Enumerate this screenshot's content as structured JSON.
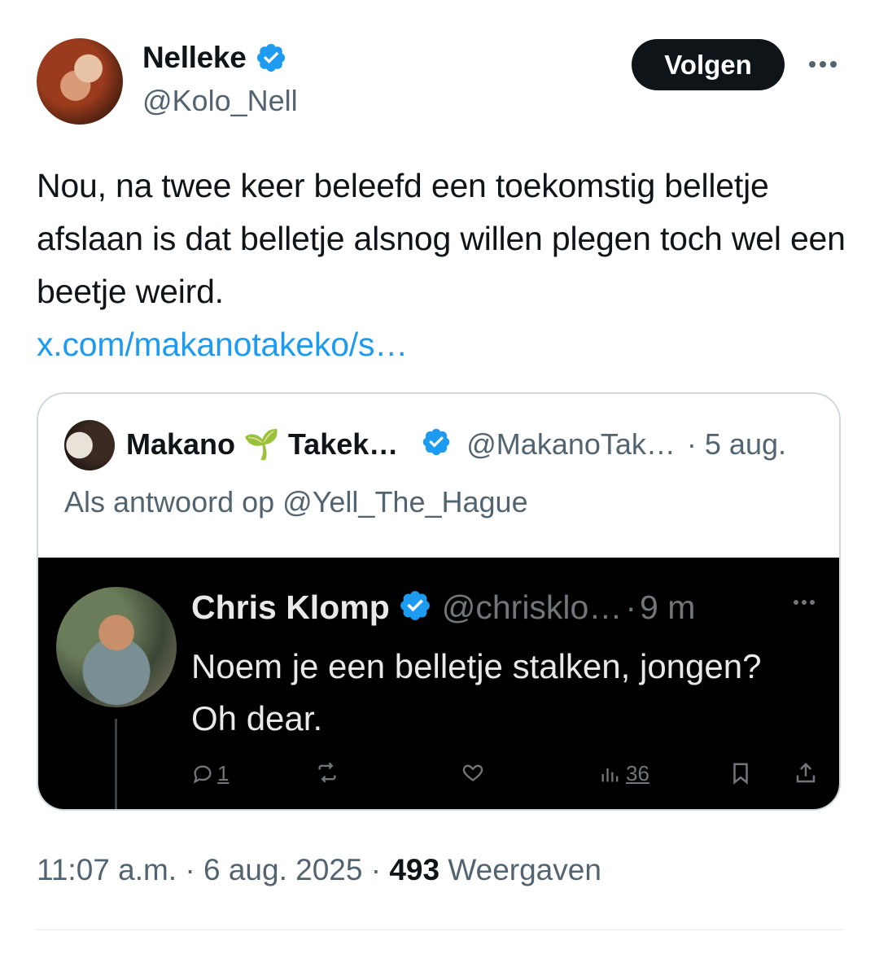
{
  "author": {
    "name": "Nelleke",
    "handle": "@Kolo_Nell",
    "follow_label": "Volgen"
  },
  "tweet": {
    "text": "Nou, na twee keer beleefd een toekomstig belletje afslaan is dat belletje alsnog willen plegen toch wel een beetje weird.",
    "link": "x.com/makanotakeko/s…"
  },
  "quote": {
    "name": "Makano 🌱 Takek…",
    "handle": "@MakanoTak…",
    "separator": "·",
    "date": "5 aug.",
    "reply_to": "Als antwoord op @Yell_The_Hague",
    "embedded": {
      "name": "Chris Klomp",
      "handle": "@chrisklo…",
      "separator": "·",
      "time": "9 m",
      "text": "Noem je een belletje stalken, jongen? Oh dear.",
      "reply_count": "1",
      "view_count": "36"
    }
  },
  "footer": {
    "time": "11:07 a.m.",
    "dot1": "·",
    "date": "6 aug. 2025",
    "dot2": "·",
    "views": "493",
    "views_label": "Weergaven"
  },
  "colors": {
    "accent": "#1d9bf0",
    "text": "#0f1419",
    "muted": "#536471",
    "dark_bg": "#000000"
  }
}
